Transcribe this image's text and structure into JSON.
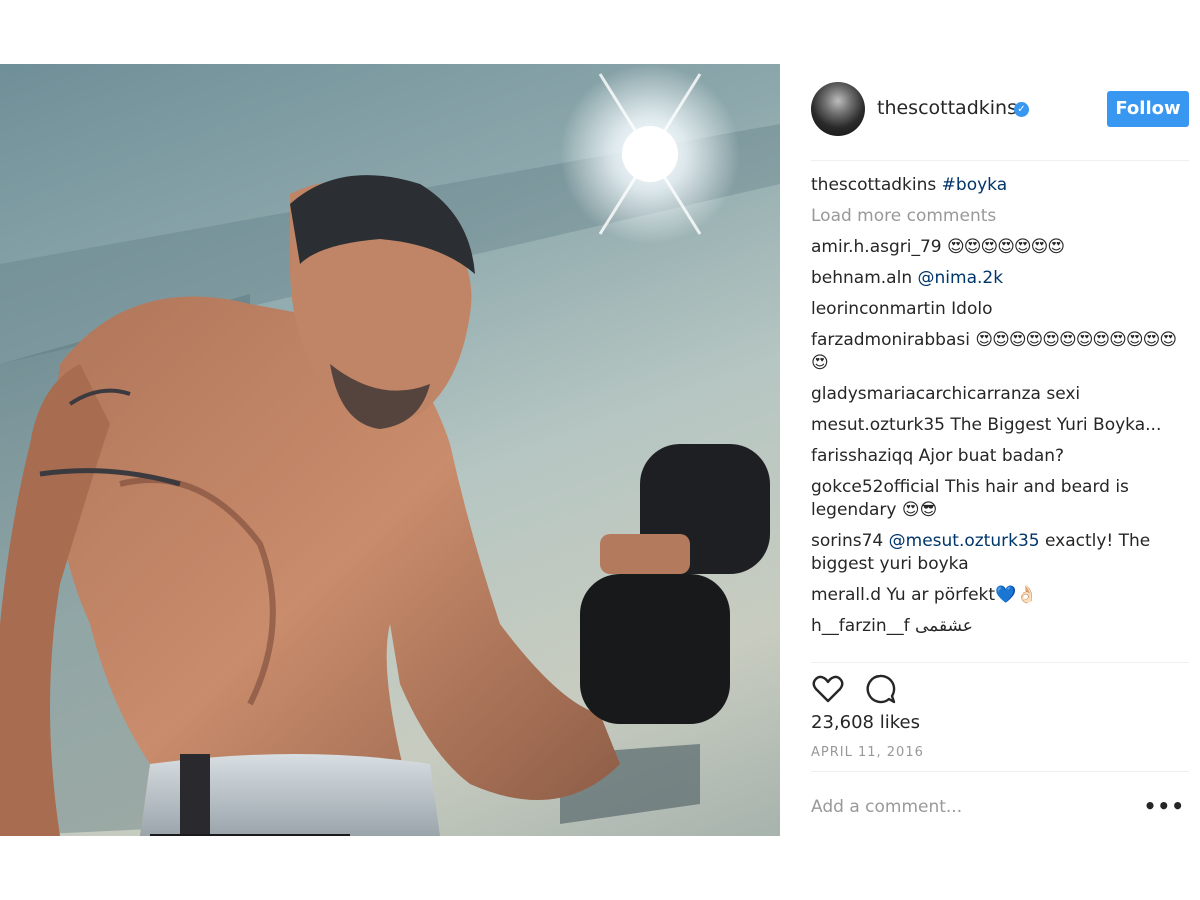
{
  "post": {
    "image_alt": "Man lifting a dumbbell in a gym",
    "author": {
      "username": "thescottadkins",
      "verified_icon": "verified-badge-icon"
    },
    "follow_label": "Follow",
    "caption": {
      "username": "thescottadkins",
      "text": "#boyka"
    },
    "load_more_label": "Load more comments",
    "comments": [
      {
        "user": "amir.h.asgri_79",
        "text": "😍😍😍😍😍😍😍"
      },
      {
        "user": "behnam.aln",
        "text": "@nima.2k",
        "is_mention": true
      },
      {
        "user": "leorinconmartin",
        "text": "Idolo"
      },
      {
        "user": "farzadmonirabbasi",
        "text": "😍😍😍😍😍😍😍😍😍😍😍😍😍"
      },
      {
        "user": "gladysmariacarchicarranza",
        "text": "sexi"
      },
      {
        "user": "mesut.ozturk35",
        "text": "The Biggest Yuri Boyka..."
      },
      {
        "user": "farisshaziqq",
        "text": "Ajor buat badan?"
      },
      {
        "user": "gokce52official",
        "text": "This hair and beard is legendary 😍😎"
      },
      {
        "user": "sorins74",
        "mention": "@mesut.ozturk35",
        "text": "exactly! The biggest yuri boyka"
      },
      {
        "user": "merall.d",
        "text": "Yu ar pörfekt💙👌🏻"
      },
      {
        "user": "h__farzin__f",
        "text": "عشقمی"
      }
    ],
    "actions": {
      "like_icon": "heart-icon",
      "comment_icon": "comment-bubble-icon"
    },
    "likes": "23,608 likes",
    "date": "APRIL 11, 2016",
    "add_comment_placeholder": "Add a comment...",
    "more_label": "•••",
    "colors": {
      "accent": "#3897f0",
      "link": "#003569",
      "muted": "#999999",
      "text": "#262626"
    }
  }
}
